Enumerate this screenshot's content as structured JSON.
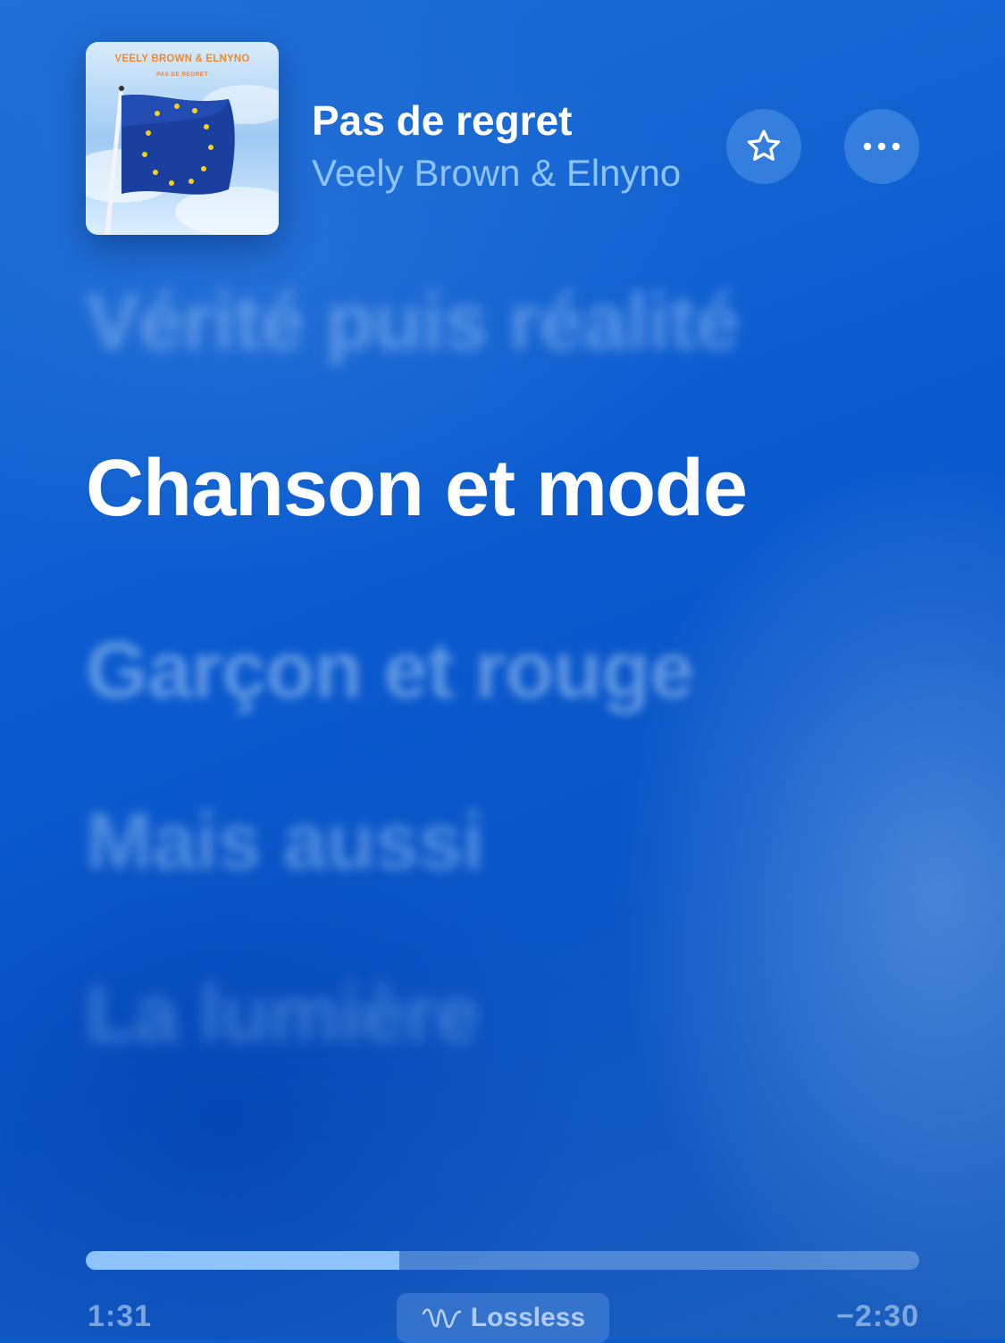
{
  "track": {
    "title": "Pas de regret",
    "artist": "Veely Brown & Elnyno",
    "artwork": {
      "artist_text": "VEELY BROWN & ELNYNO",
      "title_text": "PAS DE REGRET"
    }
  },
  "actions": {
    "favorite_icon": "star-icon",
    "more_icon": "ellipsis-icon"
  },
  "lyrics": {
    "past": "Vérité puis réalité",
    "current": "Chanson et mode",
    "upcoming": [
      "Garçon et rouge",
      "Mais aussi",
      "La lumière"
    ]
  },
  "playback": {
    "elapsed": "1:31",
    "remaining": "−2:30",
    "progress": 0.376,
    "quality_label": "Lossless",
    "quality_icon": "lossless-wave-icon"
  },
  "colors": {
    "background": "#0d5ccc",
    "accent": "#8ec3ff",
    "progress_fill": "#8ec3ff"
  }
}
